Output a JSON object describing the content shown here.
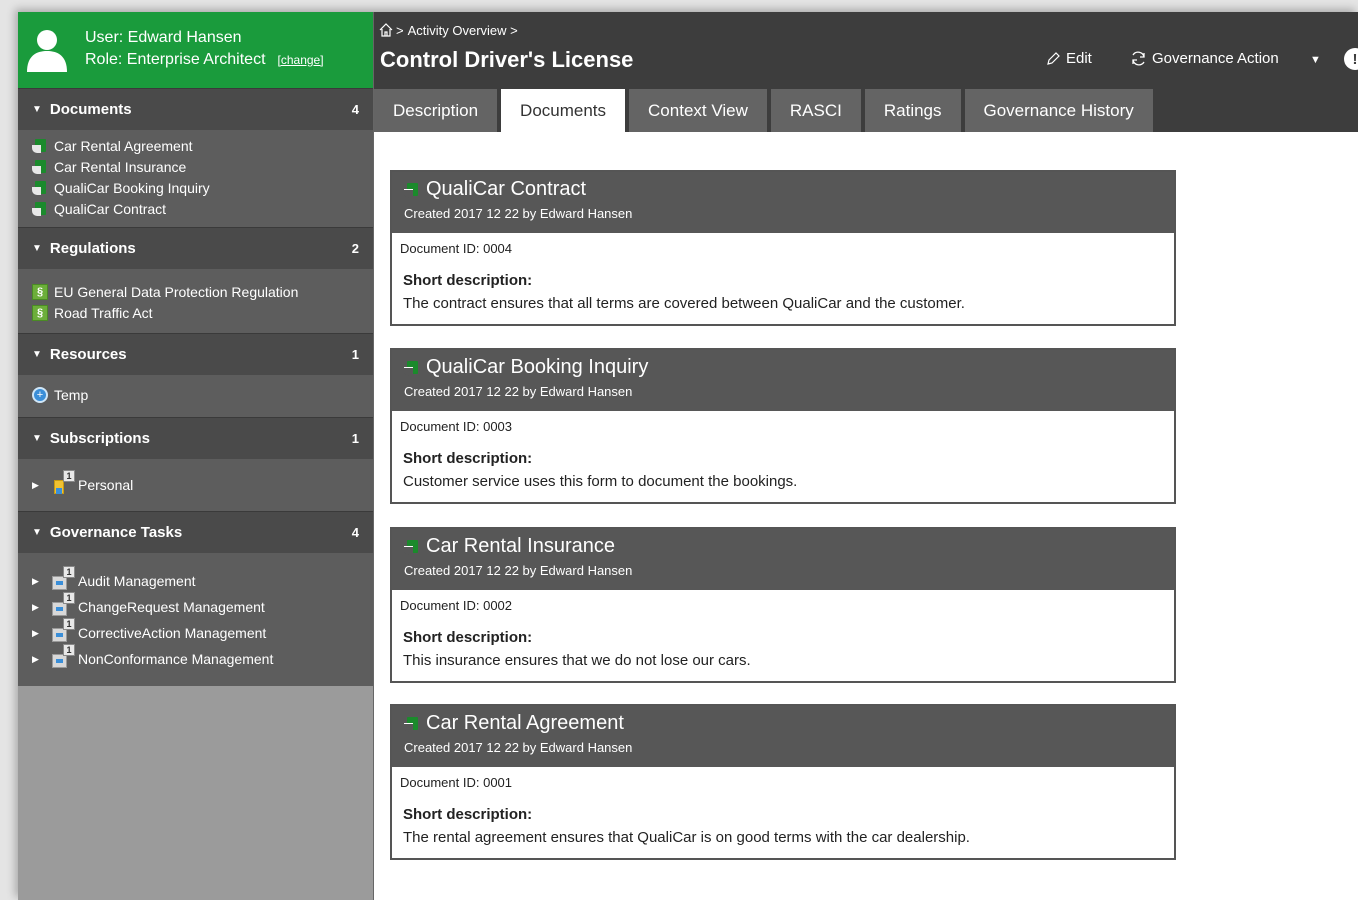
{
  "user": {
    "name_line": "User: Edward Hansen",
    "role_line": "Role: Enterprise Architect",
    "change_label": "[change]"
  },
  "sidebar": {
    "documents": {
      "title": "Documents",
      "count": "4",
      "items": [
        "Car Rental Agreement",
        "Car Rental Insurance",
        "QualiCar Booking Inquiry",
        "QualiCar Contract"
      ]
    },
    "regulations": {
      "title": "Regulations",
      "count": "2",
      "items": [
        "EU General Data Protection Regulation",
        "Road Traffic Act"
      ]
    },
    "resources": {
      "title": "Resources",
      "count": "1",
      "items": [
        "Temp"
      ]
    },
    "subscriptions": {
      "title": "Subscriptions",
      "count": "1",
      "items": [
        {
          "label": "Personal",
          "badge": "1"
        }
      ]
    },
    "governance_tasks": {
      "title": "Governance Tasks",
      "count": "4",
      "items": [
        {
          "label": "Audit Management",
          "badge": "1"
        },
        {
          "label": "ChangeRequest Management",
          "badge": "1"
        },
        {
          "label": "CorrectiveAction Management",
          "badge": "1"
        },
        {
          "label": "NonConformance Management",
          "badge": "1"
        }
      ]
    }
  },
  "header": {
    "breadcrumb": "Activity Overview >",
    "title": "Control Driver's License",
    "edit_label": "Edit",
    "governance_label": "Governance Action"
  },
  "tabs": [
    "Description",
    "Documents",
    "Context View",
    "RASCI",
    "Ratings",
    "Governance History"
  ],
  "active_tab": "Documents",
  "documents": [
    {
      "title": "QualiCar Contract",
      "created": "Created 2017 12 22 by Edward Hansen",
      "doc_id": "Document ID:  0004",
      "sd_label": "Short description:",
      "sd_text": "The contract ensures that all terms are covered between QualiCar and the customer."
    },
    {
      "title": "QualiCar Booking Inquiry",
      "created": "Created 2017 12 22 by Edward Hansen",
      "doc_id": "Document ID:  0003",
      "sd_label": "Short description:",
      "sd_text": "Customer service uses this form to document the bookings."
    },
    {
      "title": "Car Rental Insurance",
      "created": "Created 2017 12 22 by Edward Hansen",
      "doc_id": "Document ID:  0002",
      "sd_label": "Short description:",
      "sd_text": "This insurance ensures that we do not lose our cars."
    },
    {
      "title": "Car Rental Agreement",
      "created": "Created 2017 12 22 by Edward Hansen",
      "doc_id": "Document ID:  0001",
      "sd_label": "Short description:",
      "sd_text": "The rental agreement ensures that QualiCar is on good terms with the car dealership."
    }
  ],
  "colors": {
    "user_green": "#1a9b3c",
    "header_dark": "#3d3d3d",
    "section_dark": "#4a4a4a",
    "tab_gray": "#646464"
  }
}
